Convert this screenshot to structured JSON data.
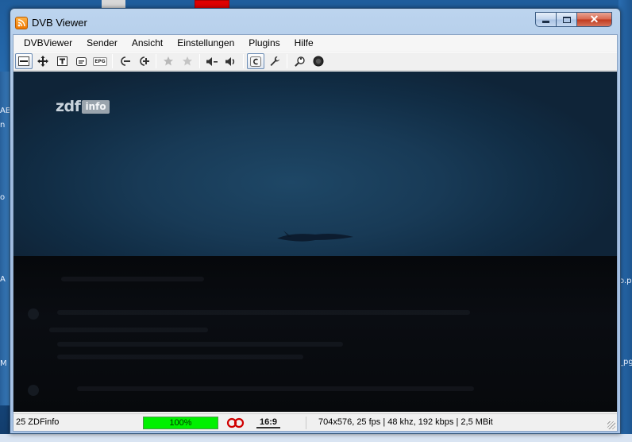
{
  "window": {
    "title": "DVB Viewer",
    "controls": {
      "minimize": "minimize",
      "maximize": "maximize",
      "close": "✕"
    }
  },
  "menu": {
    "items": [
      "DVBViewer",
      "Sender",
      "Ansicht",
      "Einstellungen",
      "Plugins",
      "Hilfe"
    ]
  },
  "toolbar": {
    "buttons": [
      {
        "icon": "fullscreen-bar-icon",
        "active": true
      },
      {
        "icon": "move-arrows-icon"
      },
      {
        "icon": "teletext-icon"
      },
      {
        "icon": "subtitle-icon"
      },
      {
        "icon": "epg-icon",
        "label": "EPG"
      },
      {
        "icon": "channel-prev-icon"
      },
      {
        "icon": "channel-next-icon"
      },
      {
        "icon": "favorite-add-icon"
      },
      {
        "icon": "favorite-remove-icon"
      },
      {
        "icon": "volume-down-icon"
      },
      {
        "icon": "volume-up-icon"
      },
      {
        "icon": "c-mode-icon",
        "active": true
      },
      {
        "icon": "settings-wrench-icon"
      },
      {
        "icon": "snapshot-icon"
      },
      {
        "icon": "record-icon"
      }
    ]
  },
  "video": {
    "logo_main": "zdf",
    "logo_badge": "info",
    "colors": {
      "water": "#183a56",
      "dark_band": "#07090c"
    }
  },
  "status": {
    "channel": "25 ZDFinfo",
    "signal": "100%",
    "signal_level": 1.0,
    "signal_color": "#00f000",
    "aspect": "16:9",
    "stream_info": "704x576, 25 fps | 48 khz, 192 kbps | 2,5 MBit"
  },
  "desktop": {
    "fragments": [
      "AB",
      "n",
      "o",
      "A",
      "M",
      "o.p",
      "_pg"
    ]
  }
}
